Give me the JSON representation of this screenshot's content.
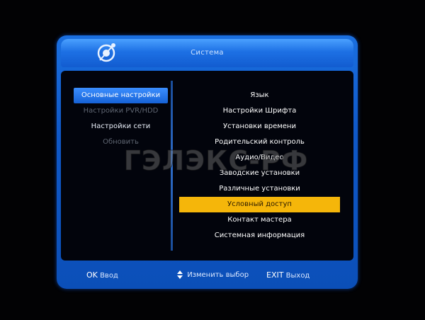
{
  "header": {
    "title": "Система"
  },
  "left_menu": [
    {
      "label": "Основные настройки",
      "state": "selected"
    },
    {
      "label": "Настройки PVR/HDD",
      "state": "disabled"
    },
    {
      "label": "Настройки сети",
      "state": "normal"
    },
    {
      "label": "Обновить",
      "state": "disabled"
    }
  ],
  "right_menu": [
    {
      "label": "Язык"
    },
    {
      "label": "Настройки Шрифта"
    },
    {
      "label": "Установки времени"
    },
    {
      "label": "Родительский контроль"
    },
    {
      "label": "Аудио/Видео"
    },
    {
      "label": "Заводские установки"
    },
    {
      "label": "Различные установки"
    },
    {
      "label": "Условный доступ",
      "selected": true
    },
    {
      "label": "Контакт мастера"
    },
    {
      "label": "Системная информация"
    }
  ],
  "footer": {
    "ok_key": "OK",
    "ok_label": "Ввод",
    "nav_label": "Изменить выбор",
    "exit_key": "EXIT",
    "exit_label": "Выход"
  },
  "watermark": {
    "text": "ГЭЛЭКС-РФ"
  },
  "colors": {
    "frame_blue": "#1a6fe0",
    "selected_left": "#1662d6",
    "selected_right": "#f5b60a",
    "background": "#020204"
  }
}
